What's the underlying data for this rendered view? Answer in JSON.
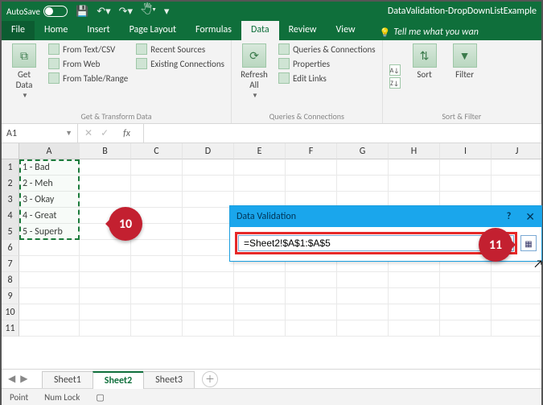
{
  "titlebar": {
    "autosave_label": "AutoSave",
    "autosave_state": "On",
    "doc_title": "DataValidation-DropDownListExample"
  },
  "tabs": {
    "file": "File",
    "items": [
      "Home",
      "Insert",
      "Page Layout",
      "Formulas",
      "Data",
      "Review",
      "View"
    ],
    "active": "Data",
    "tellme": "Tell me what you wan"
  },
  "ribbon": {
    "get_data_label": "Get\nData",
    "from_text_csv": "From Text/CSV",
    "from_web": "From Web",
    "from_table": "From Table/Range",
    "recent_sources": "Recent Sources",
    "existing_conn": "Existing Connections",
    "group1_label": "Get & Transform Data",
    "refresh_all": "Refresh\nAll",
    "queries_conn": "Queries & Connections",
    "properties": "Properties",
    "edit_links": "Edit Links",
    "group2_label": "Queries & Connections",
    "sort": "Sort",
    "filter": "Filter",
    "group3_label": "Sort & Filter"
  },
  "formula_bar": {
    "name_box": "A1",
    "fx": "fx",
    "formula": ""
  },
  "grid": {
    "columns": [
      "A",
      "B",
      "C",
      "D",
      "E",
      "F",
      "G",
      "H",
      "I",
      "J"
    ],
    "rows": 11,
    "selected_rows": 5,
    "data_col_a": [
      "1 - Bad",
      "2 - Meh",
      "3 - Okay",
      "4 - Great",
      "5 - Superb"
    ]
  },
  "dv_popup": {
    "title": "Data Validation",
    "help": "?",
    "close": "✕",
    "input_value": "=Sheet2!$A$1:$A$5"
  },
  "sheets": {
    "tabs": [
      "Sheet1",
      "Sheet2",
      "Sheet3"
    ],
    "active": "Sheet2"
  },
  "status": {
    "mode": "Point",
    "numlock": "Num Lock"
  },
  "callouts": {
    "c10": "10",
    "c11": "11"
  }
}
